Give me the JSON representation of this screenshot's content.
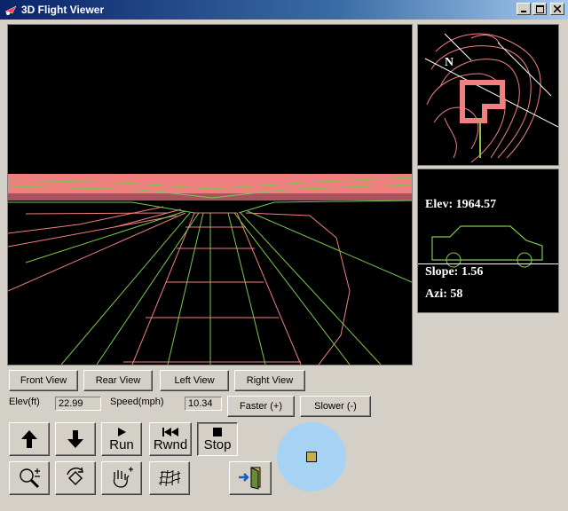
{
  "window": {
    "title": "3D Flight Viewer",
    "controls": [
      "minimize",
      "maximize",
      "close"
    ]
  },
  "views": {
    "front": "Front View",
    "rear": "Rear View",
    "left": "Left View",
    "right": "Right View"
  },
  "readouts": {
    "elev_label": "Elev(ft)",
    "elev_value": "22.99",
    "speed_label": "Speed(mph)",
    "speed_value": "10.34"
  },
  "speed_buttons": {
    "faster": "Faster (+)",
    "slower": "Slower (-)"
  },
  "transport": {
    "up_icon": "arrow-up-icon",
    "down_icon": "arrow-down-icon",
    "run": "Run",
    "rewind": "Rwnd",
    "stop": "Stop"
  },
  "tools": {
    "zoom": "zoom-icon",
    "rotate": "rotate-icon",
    "pan": "hand-pan-icon",
    "terrain": "terrain-mesh-icon",
    "exit": "exit-door-icon"
  },
  "map": {
    "north_label": "N"
  },
  "info": {
    "elev": "Elev: 1964.57",
    "slope": "Slope: 1.56",
    "azimuth": "Azi: 58"
  },
  "colors": {
    "terrain": "#f08080",
    "road": "#7cc850",
    "globe": "#a6d2f4"
  }
}
